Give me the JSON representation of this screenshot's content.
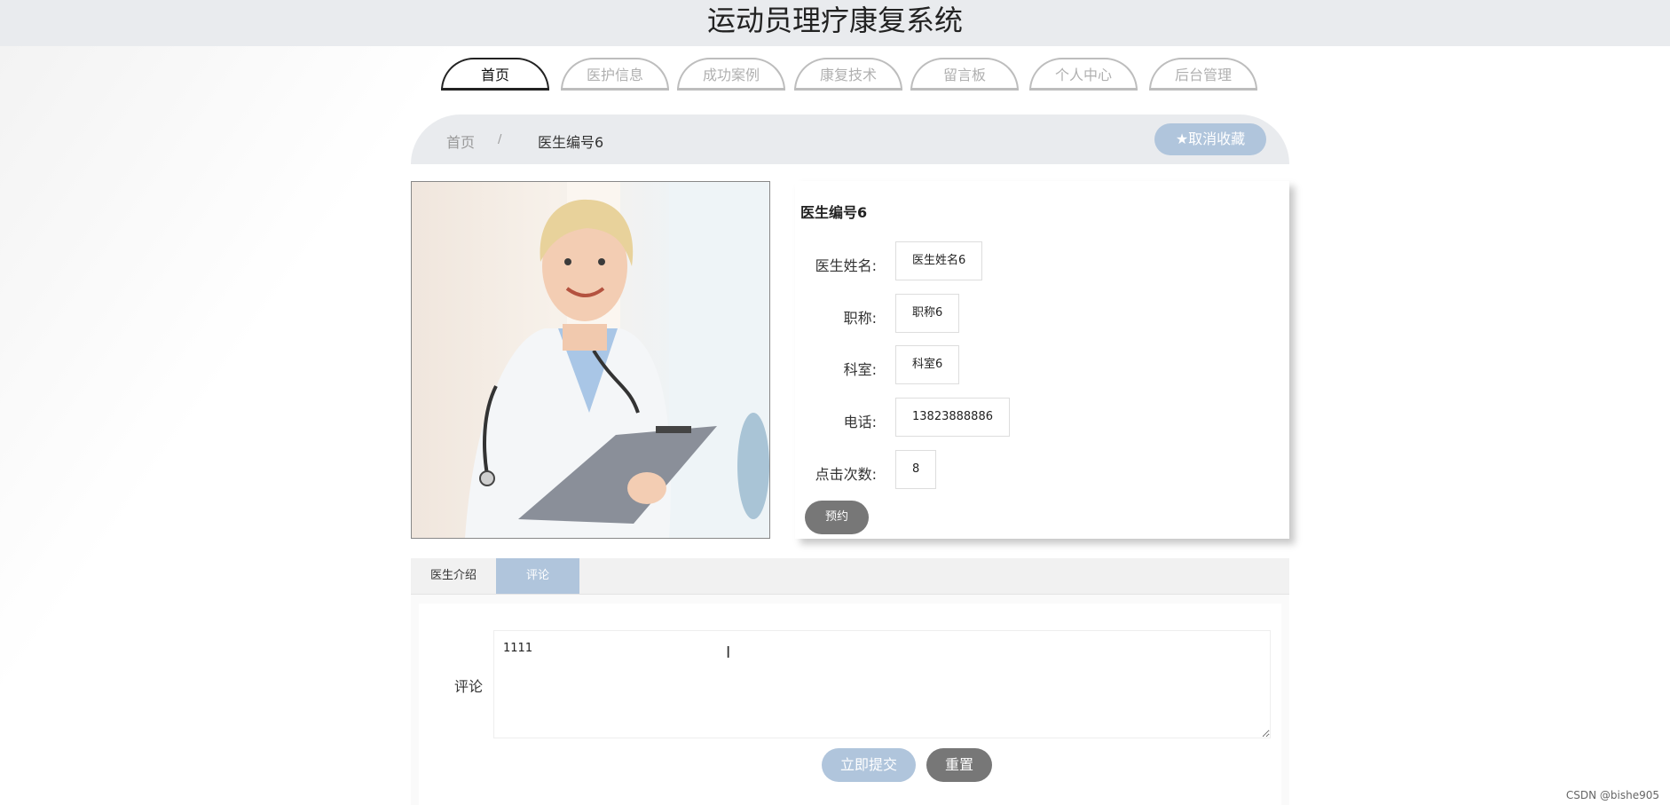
{
  "app": {
    "title": "运动员理疗康复系统"
  },
  "nav": {
    "items": [
      {
        "label": "首页"
      },
      {
        "label": "医护信息"
      },
      {
        "label": "成功案例"
      },
      {
        "label": "康复技术"
      },
      {
        "label": "留言板"
      },
      {
        "label": "个人中心"
      },
      {
        "label": "后台管理"
      }
    ]
  },
  "breadcrumb": {
    "home": "首页",
    "separator": "/",
    "current": "医生编号6"
  },
  "favorite_button": {
    "icon": "star-icon",
    "label": "取消收藏"
  },
  "doctor": {
    "heading": "医生编号6",
    "fields": [
      {
        "label": "医生姓名:",
        "value": "医生姓名6"
      },
      {
        "label": "职称:",
        "value": "职称6"
      },
      {
        "label": "科室:",
        "value": "科室6"
      },
      {
        "label": "电话:",
        "value": "13823888886"
      },
      {
        "label": "点击次数:",
        "value": "8"
      }
    ],
    "book_label": "预约"
  },
  "tabs": [
    {
      "label": "医生介绍"
    },
    {
      "label": "评论"
    }
  ],
  "comment": {
    "label": "评论",
    "value": "1111",
    "submit_label": "立即提交",
    "reset_label": "重置"
  },
  "watermark": "CSDN @bishe905",
  "colors": {
    "accent": "#b0c5dc",
    "dark_button": "#777777",
    "header_bg": "#e9ebee"
  }
}
